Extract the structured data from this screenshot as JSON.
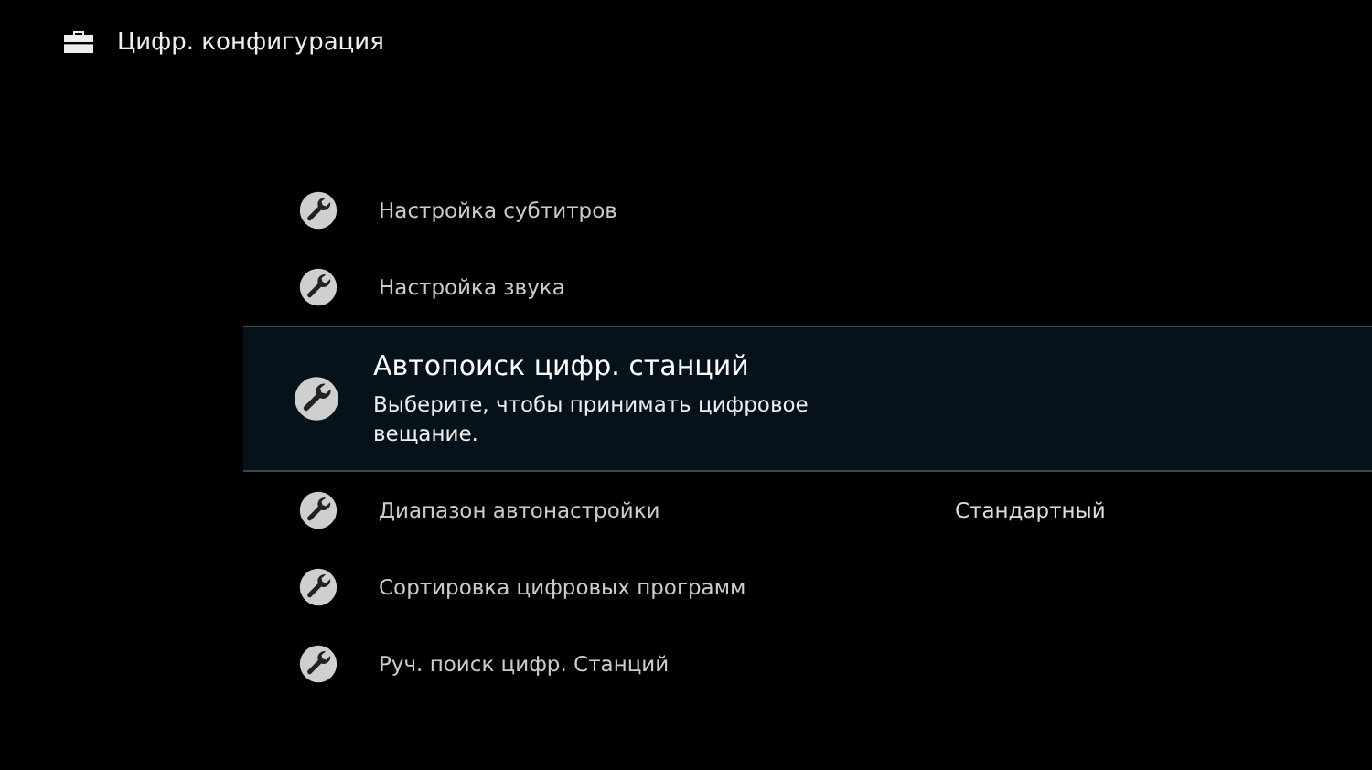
{
  "header": {
    "title": "Цифр. конфигурация"
  },
  "items": [
    {
      "label": "Настройка субтитров",
      "selected": false
    },
    {
      "label": "Настройка звука",
      "selected": false
    },
    {
      "label": "Автопоиск цифр. станций",
      "selected": true,
      "description": "Выберите, чтобы принимать цифровое вещание."
    },
    {
      "label": "Диапазон автонастройки",
      "selected": false,
      "value": "Стандартный"
    },
    {
      "label": "Сортировка цифровых программ",
      "selected": false
    },
    {
      "label": "Руч. поиск цифр. Станций",
      "selected": false
    }
  ]
}
